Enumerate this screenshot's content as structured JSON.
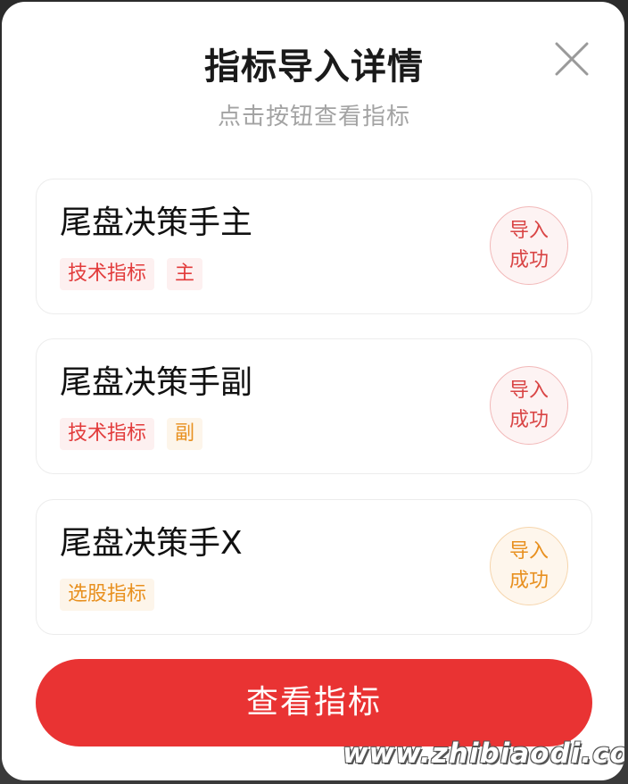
{
  "modal": {
    "title": "指标导入详情",
    "subtitle": "点击按钮查看指标",
    "close_icon": "close-icon"
  },
  "indicators": [
    {
      "name": "尾盘决策手主",
      "tags": [
        {
          "label": "技术指标",
          "color": "#e23b3b"
        },
        {
          "label": "主",
          "color": "#e23b3b"
        }
      ],
      "status_line1": "导入",
      "status_line2": "成功",
      "status_color": "#d94545"
    },
    {
      "name": "尾盘决策手副",
      "tags": [
        {
          "label": "技术指标",
          "color": "#e23b3b"
        },
        {
          "label": "副",
          "color": "#e8901f"
        }
      ],
      "status_line1": "导入",
      "status_line2": "成功",
      "status_color": "#d94545"
    },
    {
      "name": "尾盘决策手X",
      "tags": [
        {
          "label": "选股指标",
          "color": "#e8901f"
        }
      ],
      "status_line1": "导入",
      "status_line2": "成功",
      "status_color": "#e8901f"
    }
  ],
  "action": {
    "view_button_label": "查看指标",
    "color": "#e93333"
  },
  "watermark": "www.zhibiaodi.com"
}
